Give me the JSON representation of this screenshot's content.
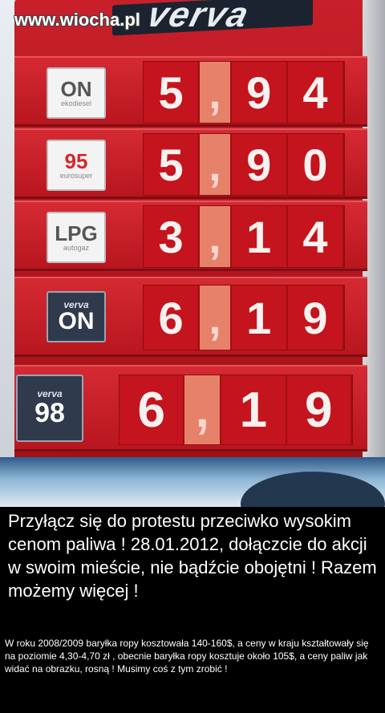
{
  "watermark": "www.wiocha.pl",
  "brand": "verva",
  "rows": [
    {
      "logo_main": "ON",
      "logo_sub": "ekodiesel",
      "digits": [
        "5",
        ",",
        "9",
        "4"
      ]
    },
    {
      "logo_main": "95",
      "logo_sub": "eurosuper",
      "digits": [
        "5",
        ",",
        "9",
        "0"
      ]
    },
    {
      "logo_main": "LPG",
      "logo_sub": "autogaz",
      "digits": [
        "3",
        ",",
        "1",
        "4"
      ]
    },
    {
      "logo_main": "ON",
      "logo_sub": "verva",
      "digits": [
        "6",
        ",",
        "1",
        "9"
      ]
    },
    {
      "logo_main": "98",
      "logo_sub": "verva",
      "digits": [
        "6",
        ",",
        "1",
        "9"
      ]
    }
  ],
  "caption": {
    "headline": "Przyłącz się do protestu przeciwko wysokim cenom paliwa ! 28.01.2012, dołączcie do akcji w swoim mieście, nie bądźcie obojętni ! Razem możemy więcej !",
    "body": "W roku 2008/2009 baryłka ropy kosztowała 140-160$, a ceny w kraju kształtowały się na poziomie 4,30-4,70 zł , obecnie baryłka ropy kosztuje około 105$, a ceny paliw jak widać na obrazku, rosną ! Musimy coś z tym zrobić !"
  }
}
